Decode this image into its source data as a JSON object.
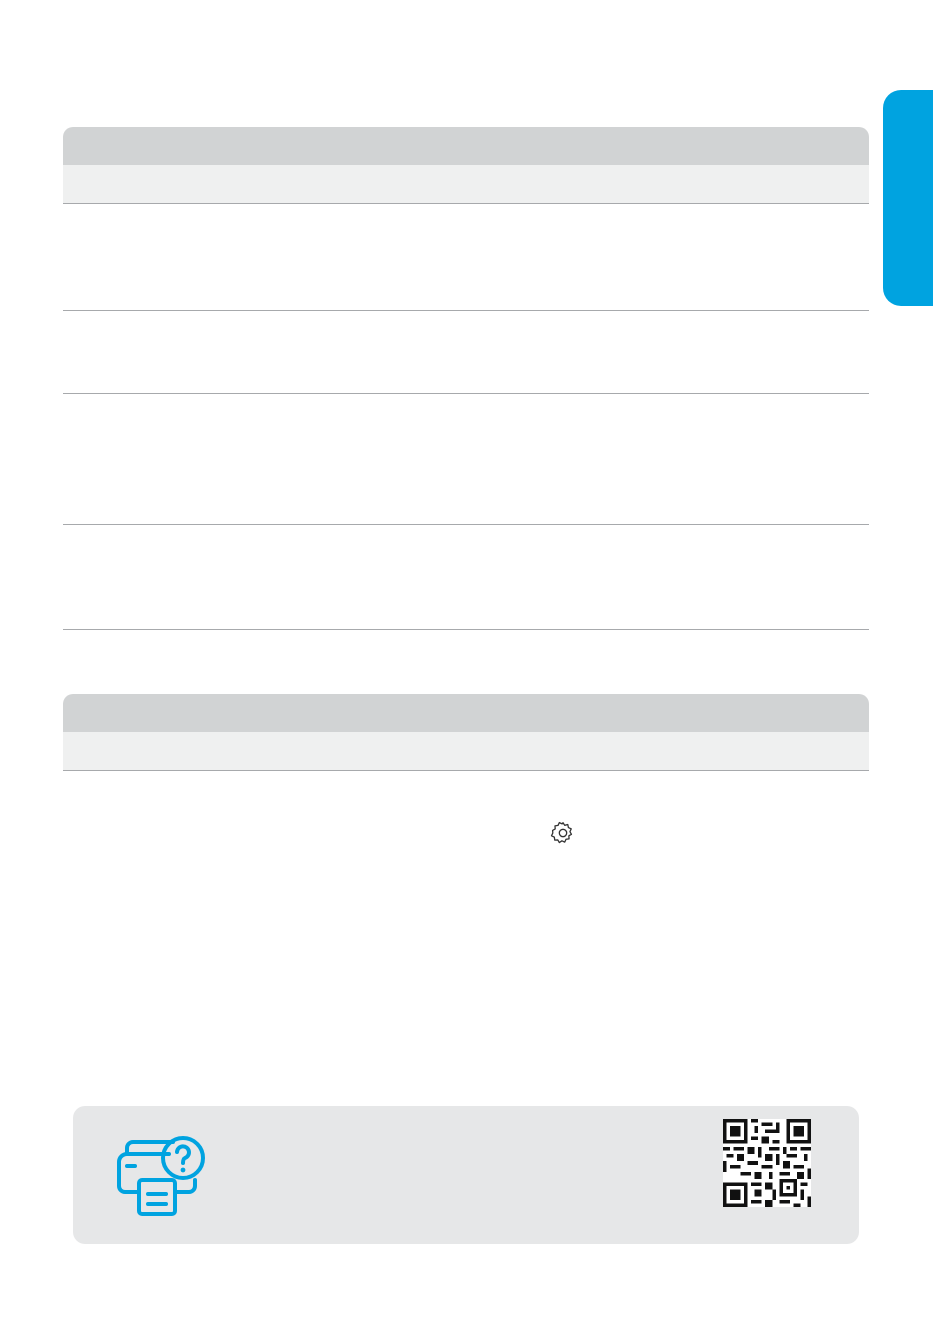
{
  "accent_color": "#00a3e0",
  "section_header_color": "#d1d3d4",
  "section_subheader_color": "#eff0f0",
  "help_box_color": "#e6e7e8",
  "icons": [
    "gear-icon",
    "printer-help-icon",
    "qr-code"
  ]
}
